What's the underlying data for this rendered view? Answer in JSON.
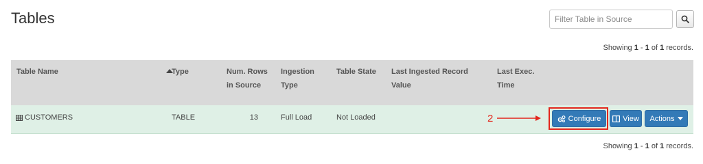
{
  "page": {
    "title": "Tables"
  },
  "search": {
    "placeholder": "Filter Table in Source",
    "value": ""
  },
  "pagination": {
    "prefix": "Showing ",
    "from": "1",
    "sep": " - ",
    "to": "1",
    "of": " of ",
    "total": "1",
    "suffix": " records."
  },
  "table": {
    "headers": {
      "name": "Table Name",
      "type": "Type",
      "rows_line1": "Num. Rows",
      "rows_line2": "in Source",
      "ingestion_line1": "Ingestion",
      "ingestion_line2": "Type",
      "state": "Table State",
      "last_ingested_line1": "Last Ingested Record",
      "last_ingested_line2": "Value",
      "last_exec_line1": "Last Exec.",
      "last_exec_line2": "Time"
    },
    "rows": [
      {
        "name": "CUSTOMERS",
        "type": "TABLE",
        "num_rows": "13",
        "ingestion_type": "Full Load",
        "state": "Not Loaded",
        "last_ingested": "",
        "last_exec": ""
      }
    ]
  },
  "actions": {
    "configure": "Configure",
    "view": "View",
    "actions": "Actions"
  },
  "annotation": {
    "number": "2"
  },
  "colors": {
    "primary": "#337ab7",
    "row_bg": "#dff0e6",
    "header_bg": "#d9d9d9",
    "annotation": "#e3261c"
  },
  "icons": {
    "search": "search-icon",
    "sort": "sort-asc-icon",
    "table": "table-grid-icon",
    "configure": "cogs-icon",
    "view": "columns-icon",
    "dropdown": "caret-down-icon"
  }
}
